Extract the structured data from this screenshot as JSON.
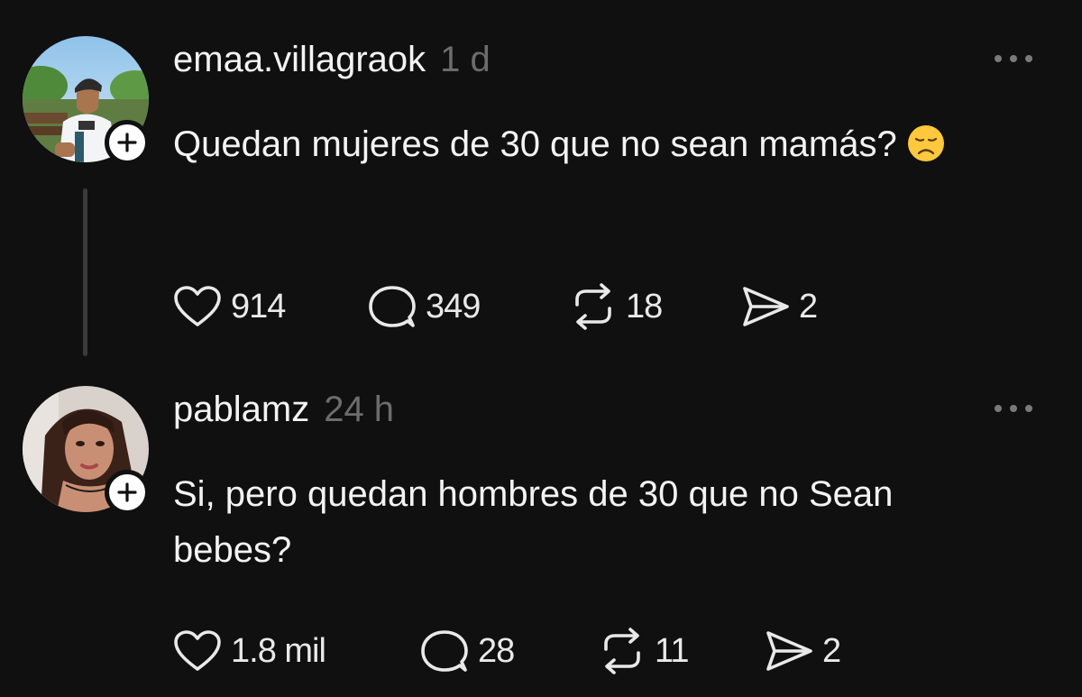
{
  "posts": [
    {
      "username": "emaa.villagraok",
      "time": "1 d",
      "text": "Quedan mujeres de 30 que no sean mamás?",
      "emoji_icon": "disappointed-face-emoji",
      "likes": "914",
      "comments": "349",
      "reposts": "18",
      "shares": "2"
    },
    {
      "username": "pablamz",
      "time": "24 h",
      "text": "Si, pero quedan hombres de 30 que no Sean bebes?",
      "likes": "1.8 mil",
      "comments": "28",
      "reposts": "11",
      "shares": "2"
    }
  ],
  "icons": {
    "like": "heart-icon",
    "comment": "comment-bubble-icon",
    "repost": "repost-icon",
    "share": "send-icon",
    "more": "more-dots-icon",
    "follow": "plus-icon"
  },
  "colors": {
    "background": "#101010",
    "text": "#f3f3f3",
    "muted": "#6c6c6c",
    "thread_line": "#3a3a3a"
  }
}
